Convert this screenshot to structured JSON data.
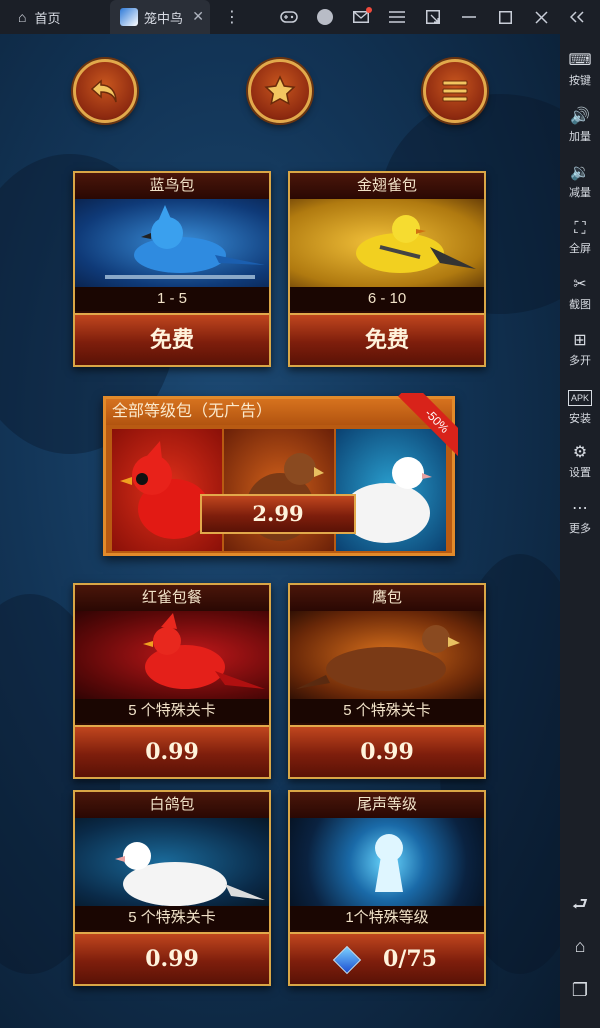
{
  "topbar": {
    "home_label": "首页",
    "game_tab_label": "笼中鸟",
    "close_glyph": "✕",
    "dots_glyph": "⋮"
  },
  "sidebar": {
    "items": [
      {
        "label": "按键",
        "icon": "keyboard-icon"
      },
      {
        "label": "加量",
        "icon": "volume-up-icon"
      },
      {
        "label": "减量",
        "icon": "volume-down-icon"
      },
      {
        "label": "全屏",
        "icon": "fullscreen-icon"
      },
      {
        "label": "截图",
        "icon": "scissors-icon"
      },
      {
        "label": "多开",
        "icon": "multi-open-icon"
      },
      {
        "label": "安装",
        "icon": "apk-install-icon"
      },
      {
        "label": "设置",
        "icon": "gear-icon"
      },
      {
        "label": "更多",
        "icon": "more-icon"
      }
    ]
  },
  "packs": {
    "bluebird": {
      "title": "蓝鸟包",
      "sub": "1 - 5",
      "button": "免费"
    },
    "goldfinch": {
      "title": "金翅雀包",
      "sub": "6 - 10",
      "button": "免费"
    },
    "cardinal": {
      "title": "红雀包餐",
      "sub": "5 个特殊关卡",
      "button": "0.99"
    },
    "hawk": {
      "title": "鹰包",
      "sub": "5 个特殊关卡",
      "button": "0.99"
    },
    "dove": {
      "title": "白鸽包",
      "sub": "5 个特殊关卡",
      "button": "0.99"
    },
    "encore": {
      "title": "尾声等级",
      "sub": "1个特殊等级",
      "button": "0/75"
    }
  },
  "bundle": {
    "title": "全部等级包（无广告）",
    "price": "2.99",
    "discount": "-50%"
  },
  "colors": {
    "accent_gold": "#d9a646",
    "button_red": "#8e2a10",
    "bundle_orange": "#d6721e",
    "ribbon_red": "#d8231a"
  }
}
